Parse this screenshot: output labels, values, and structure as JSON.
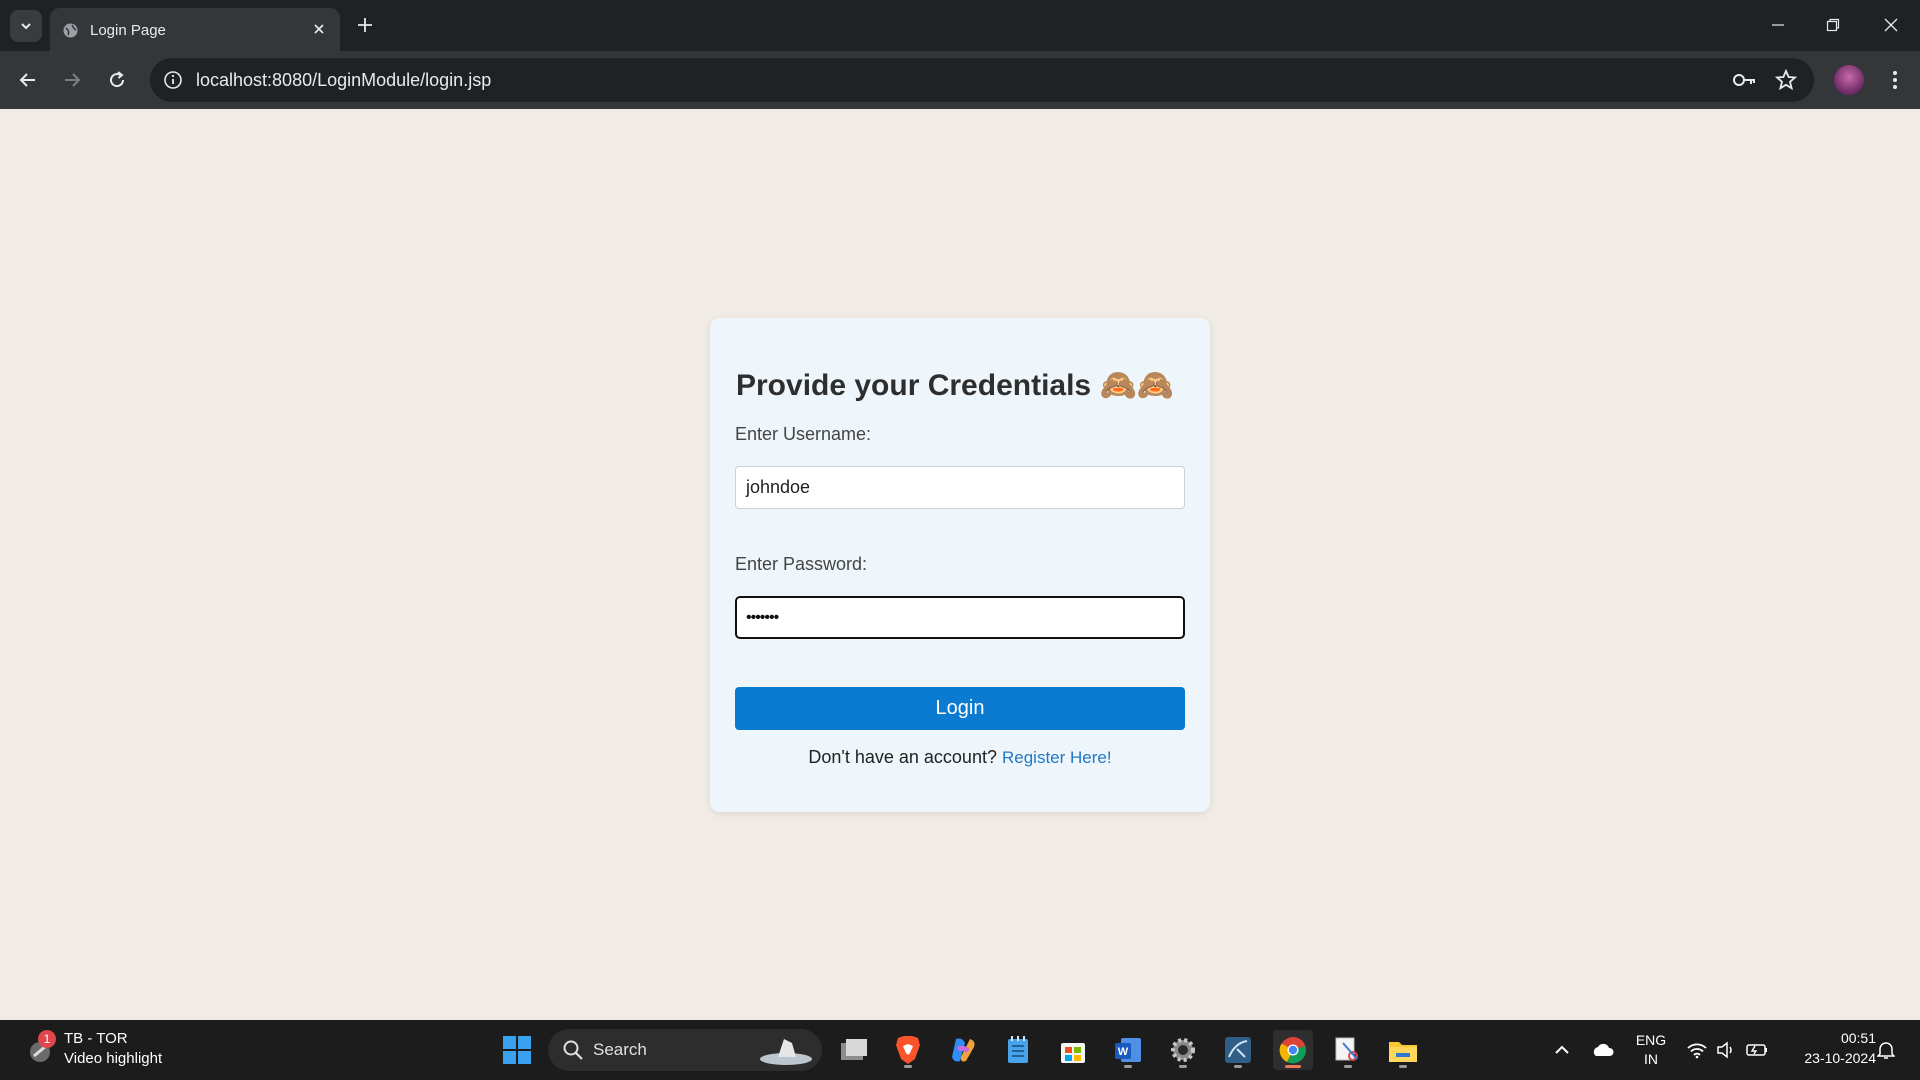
{
  "browser": {
    "tab_title": "Login Page",
    "url": "localhost:8080/LoginModule/login.jsp"
  },
  "form": {
    "heading": "Provide your Credentials 🙈🙈",
    "username_label": "Enter Username:",
    "username_value": "johndoe",
    "password_label": "Enter Password:",
    "password_value": "•••••••",
    "login_label": "Login",
    "register_prompt": "Don't have an account?",
    "register_link": "Register Here!"
  },
  "taskbar": {
    "notification_badge": "1",
    "notification_title": "TB - TOR",
    "notification_subtitle": "Video highlight",
    "search_label": "Search",
    "language_top": "ENG",
    "language_bottom": "IN",
    "time": "00:51",
    "date": "23-10-2024"
  },
  "colors": {
    "page_bg": "#f0ebe5",
    "card_bg": "#eef6fb",
    "button_bg": "#0b7ad1",
    "link": "#1f78c8"
  }
}
